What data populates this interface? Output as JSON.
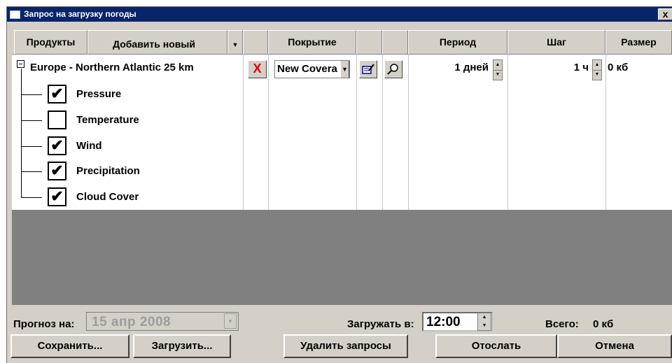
{
  "window": {
    "title": "Запрос на загрузку погоды",
    "close_label": "x"
  },
  "columns": {
    "products": "Продукты",
    "add_new": "Добавить новый",
    "coverage": "Покрытие",
    "period": "Период",
    "step": "Шаг",
    "size": "Размер"
  },
  "request": {
    "product_group": "Europe - Northern Atlantic 25 km",
    "coverage_value": "New Covera",
    "period_value": "1 дней",
    "step_value": "1 ч",
    "size_value": "0 кб",
    "delete_glyph": "X",
    "products": [
      {
        "label": "Pressure",
        "checked": true,
        "mark": "✔"
      },
      {
        "label": "Temperature",
        "checked": false,
        "mark": ""
      },
      {
        "label": "Wind",
        "checked": true,
        "mark": "✔"
      },
      {
        "label": "Precipitation",
        "checked": true,
        "mark": "✔"
      },
      {
        "label": "Cloud Cover",
        "checked": true,
        "mark": "✔"
      }
    ]
  },
  "footer": {
    "forecast_label": "Прогноз на:",
    "forecast_date": "15 апр 2008",
    "download_at_label": "Загружать в:",
    "download_time": "12:00",
    "total_label": "Всего:",
    "total_value": "0 кб"
  },
  "buttons": {
    "save": "Сохранить...",
    "load": "Загрузить...",
    "delete_requests": "Удалить запросы",
    "send": "Отослать",
    "cancel": "Отмена"
  },
  "colors": {
    "title_bar": "#0a246a",
    "face": "#d4d0c8",
    "empty_area": "#808080",
    "delete_mark": "#e00000"
  },
  "icons": {
    "add_dropdown": "chevron-down-icon",
    "delete": "x-icon",
    "edit_coverage": "edit-icon",
    "view_coverage": "magnifier-icon"
  }
}
